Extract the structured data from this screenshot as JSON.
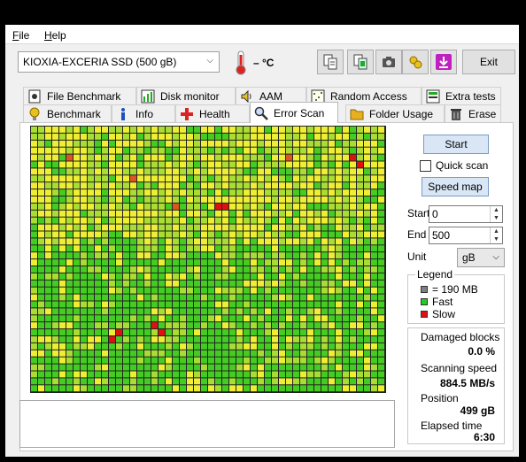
{
  "menu": {
    "file": "File",
    "file_u": "F",
    "file_rest": "ile",
    "help": "Help",
    "help_u": "H",
    "help_rest": "elp"
  },
  "drive": {
    "selected": "KIOXIA-EXCERIA SSD (500 gB)"
  },
  "temperature": "– °C",
  "toolbar": {
    "exit_label": "Exit",
    "icons": [
      "copy-info-icon",
      "copy-text-icon",
      "screenshot-icon",
      "options-icon",
      "download-icon"
    ]
  },
  "tabs_back": [
    {
      "label": "File Benchmark",
      "icon": "file-benchmark-icon"
    },
    {
      "label": "Disk monitor",
      "icon": "disk-monitor-icon"
    },
    {
      "label": "AAM",
      "icon": "speaker-icon"
    },
    {
      "label": "Random Access",
      "icon": "random-access-icon"
    },
    {
      "label": "Extra tests",
      "icon": "extra-tests-icon"
    }
  ],
  "tabs_front": [
    {
      "label": "Benchmark",
      "icon": "benchmark-icon"
    },
    {
      "label": "Info",
      "icon": "info-icon"
    },
    {
      "label": "Health",
      "icon": "health-icon"
    },
    {
      "label": "Error Scan",
      "icon": "magnifier-icon",
      "active": true
    },
    {
      "label": "Folder Usage",
      "icon": "folder-icon"
    },
    {
      "label": "Erase",
      "icon": "trash-icon"
    }
  ],
  "controls": {
    "start_label": "Start",
    "quick_scan_label": "Quick scan",
    "quick_scan_checked": false,
    "speed_map_label": "Speed map",
    "start_field_label": "Start",
    "start_value": "0",
    "end_field_label": "End",
    "end_value": "500",
    "unit_label": "Unit",
    "unit_value": "gB"
  },
  "legend": {
    "title": "Legend",
    "items": [
      {
        "label": "= 190 MB",
        "color": "#808080"
      },
      {
        "label": "Fast",
        "color": "#22cc22"
      },
      {
        "label": "Slow",
        "color": "#dd1111"
      }
    ]
  },
  "stats": {
    "damaged_label": "Damaged blocks",
    "damaged_value": "0.0 %",
    "speed_label": "Scanning speed",
    "speed_value": "884.5 MB/s",
    "position_label": "Position",
    "position_value": "499 gB",
    "elapsed_label": "Elapsed time",
    "elapsed_value": "6:30"
  },
  "colors": {
    "fast": "#44cc22",
    "medium": "#aadd33",
    "yellow": "#eeee33",
    "slow": "#dd5522",
    "red": "#dd1111"
  },
  "scan_map": {
    "columns": 50,
    "rows": 38,
    "blocks_total": 1900,
    "damaged_blocks": 0
  }
}
